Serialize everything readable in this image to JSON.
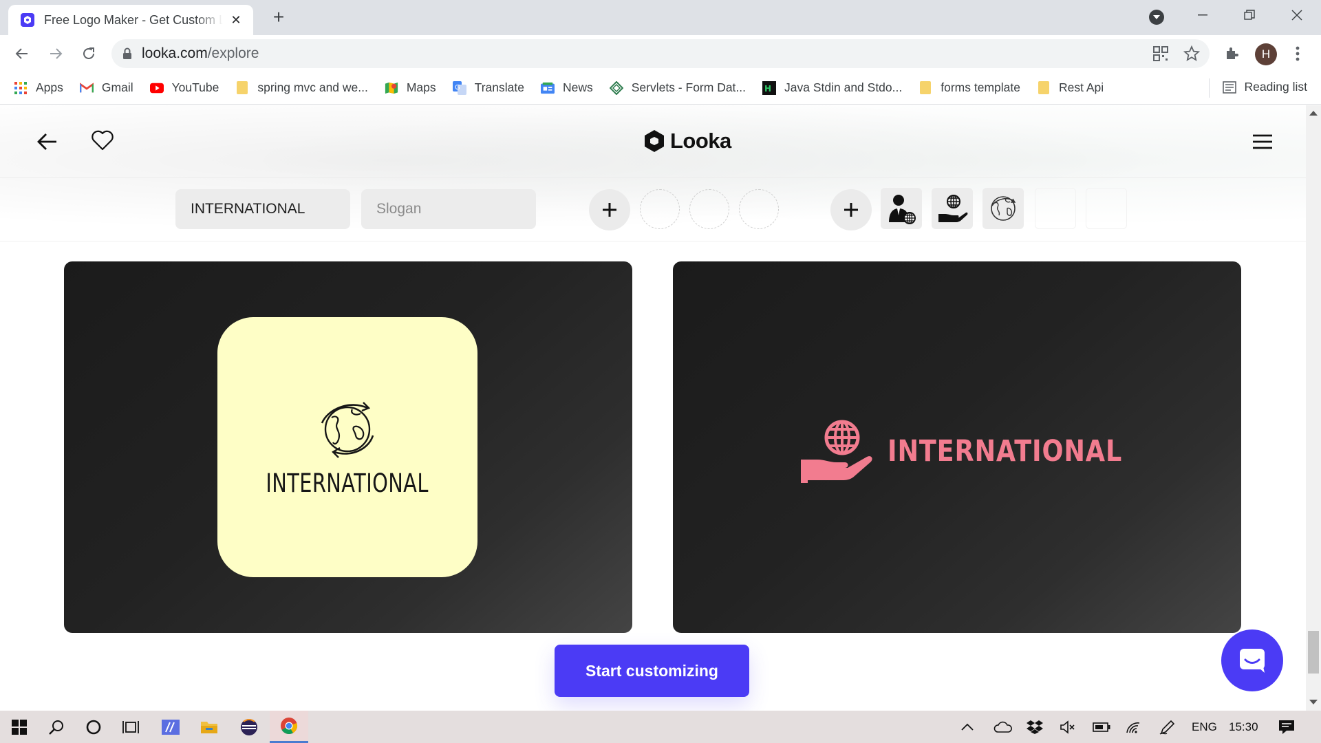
{
  "browser": {
    "tab_title": "Free Logo Maker - Get Custom Logo Designs in Minutes | Looka",
    "url_host": "looka.com",
    "url_path": "/explore",
    "profile_initial": "H",
    "bookmarks": [
      {
        "label": "Apps",
        "icon": "apps-grid-icon"
      },
      {
        "label": "Gmail",
        "icon": "gmail-icon"
      },
      {
        "label": "YouTube",
        "icon": "youtube-icon"
      },
      {
        "label": "spring mvc and we...",
        "icon": "folder-icon"
      },
      {
        "label": "Maps",
        "icon": "maps-icon"
      },
      {
        "label": "Translate",
        "icon": "translate-icon"
      },
      {
        "label": "News",
        "icon": "news-icon"
      },
      {
        "label": "Servlets - Form Dat...",
        "icon": "servlets-icon"
      },
      {
        "label": "Java Stdin and Stdo...",
        "icon": "hackerrank-icon"
      },
      {
        "label": "forms template",
        "icon": "folder-icon"
      },
      {
        "label": "Rest Api",
        "icon": "folder-icon"
      }
    ],
    "reading_list": "Reading list"
  },
  "site": {
    "brand": "Looka",
    "company_name_value": "INTERNATIONAL",
    "slogan_placeholder": "Slogan",
    "cta_label": "Start customizing"
  },
  "logos": [
    {
      "text": "INTERNATIONAL",
      "tile_color": "#fefec6",
      "icon": "globe-arrows-icon"
    },
    {
      "text": "INTERNATIONAL",
      "text_color": "#f27c8f",
      "icon": "hand-globe-icon"
    }
  ],
  "taskbar": {
    "language": "ENG",
    "time": "15:30"
  },
  "colors": {
    "accent": "#4b3bf5",
    "pink": "#f27c8f",
    "tile": "#fefec6"
  }
}
